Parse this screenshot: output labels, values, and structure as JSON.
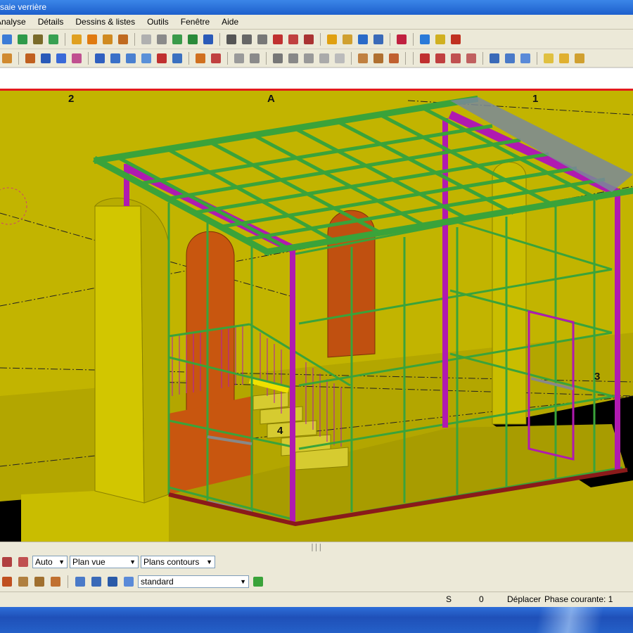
{
  "window": {
    "title": "saie verrière"
  },
  "menu": [
    "Analyse",
    "Détails",
    "Dessins & listes",
    "Outils",
    "Fenêtre",
    "Aide"
  ],
  "viewport": {
    "grid_labels": {
      "left": "2",
      "center": "A",
      "right": "1",
      "side": "3",
      "inner": "4"
    },
    "colors": {
      "background": "#c2b400",
      "frame": "#3aa33a",
      "post": "#b01ab0",
      "arch": "#c05010",
      "floor_edge": "#8a1a1a"
    }
  },
  "bottom": {
    "combo_auto": "Auto",
    "combo_view": "Plan vue",
    "combo_contours": "Plans contours",
    "combo_standard": "standard"
  },
  "status": {
    "s": "S",
    "count": "0",
    "mode": "Déplacer",
    "phase": "Phase courante: 1"
  }
}
